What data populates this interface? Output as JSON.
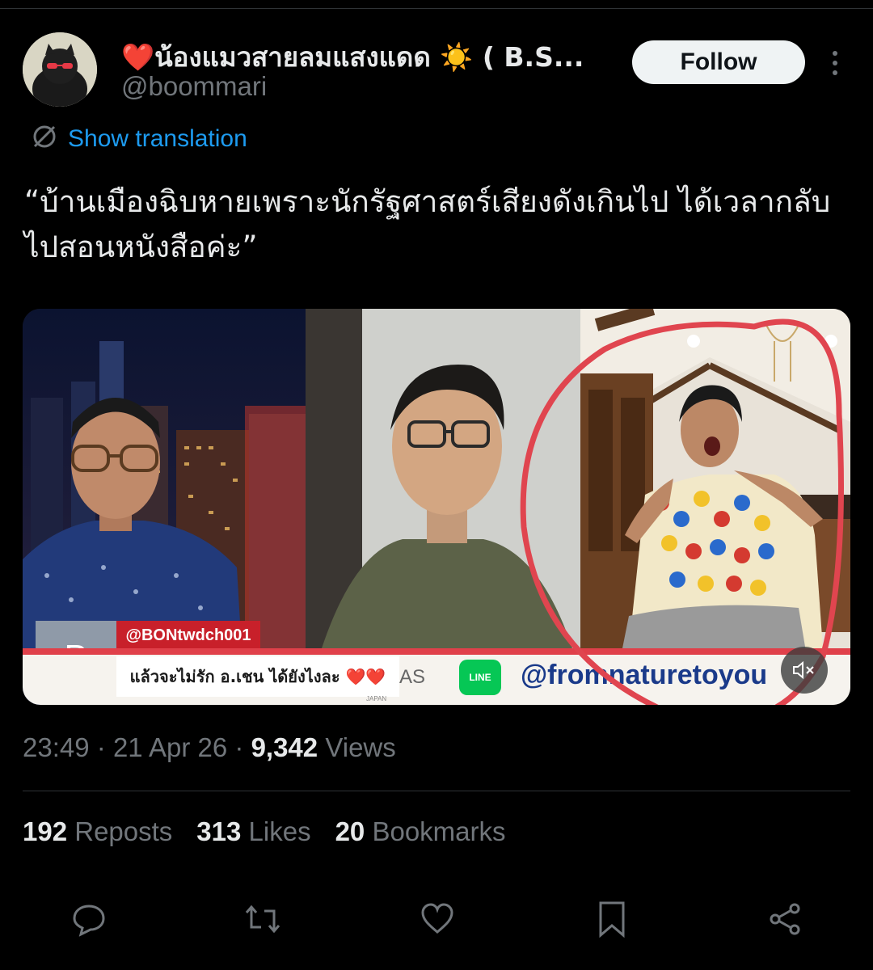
{
  "user": {
    "display_name": "❤️น้องแมวสายลมแสงแดด ☀️ ( B.S...",
    "handle": "@boommari",
    "follow_label": "Follow"
  },
  "translate_label": "Show translation",
  "tweet_text": "“บ้านเมืองฉิบหายเพราะนักรัฐศาสตร์เสียงดังเกินไป ได้เวลากลับไปสอนหนังสือค่ะ”",
  "media": {
    "overlay_handle": "@BONtwdch001",
    "overlay_letter": "B",
    "overlay_caption": "แล้วจะไม่รัก อ.เชน ได้ยังไงละ ❤️❤️",
    "overlay_small": "JAPAN",
    "overlay_partial": "AS",
    "line_badge": "LINE",
    "overlay_channel": "@fromnaturetoyou"
  },
  "meta": {
    "time": "23:49",
    "date": "21 Apr 26",
    "views_count": "9,342",
    "views_label": "Views"
  },
  "stats": {
    "reposts_count": "192",
    "reposts_label": "Reposts",
    "likes_count": "313",
    "likes_label": "Likes",
    "bookmarks_count": "20",
    "bookmarks_label": "Bookmarks"
  },
  "colors": {
    "accent": "#1d9bf0",
    "background": "#000000",
    "muted": "#71767b",
    "annotation": "#e0454f"
  }
}
